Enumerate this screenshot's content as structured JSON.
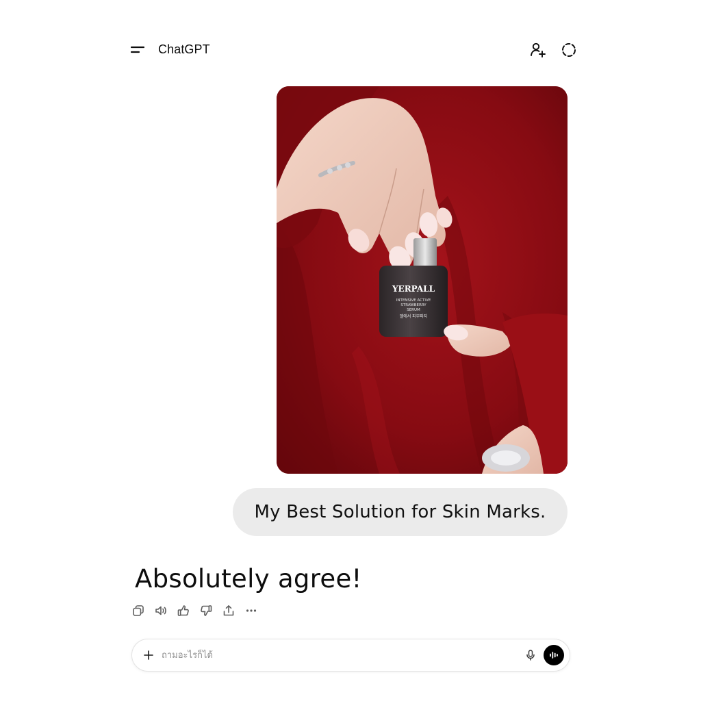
{
  "header": {
    "title": "ChatGPT",
    "menu_icon": "menu-icon",
    "add_person_icon": "add-person-icon",
    "temp_chat_icon": "dashed-circle-icon"
  },
  "conversation": {
    "user_image": {
      "product_brand": "YERPALL",
      "product_lines": [
        "INTENSIVE ACTIVE",
        "STRAWBERRY",
        "SERUM"
      ],
      "product_korean": "멜에서 피부파지",
      "colors": {
        "background": "#8c0b10",
        "bottle": "#3a3436"
      }
    },
    "user_message": "My Best Solution for Skin Marks.",
    "assistant_message": "Absolutely agree!",
    "actions": [
      "copy-icon",
      "read-aloud-icon",
      "thumbs-up-icon",
      "thumbs-down-icon",
      "share-icon",
      "more-icon"
    ]
  },
  "composer": {
    "placeholder": "ถามอะไรก็ได้",
    "value": "",
    "plus_icon": "plus-icon",
    "mic_icon": "mic-icon",
    "voice_icon": "voice-mode-icon"
  },
  "colors": {
    "bubble": "#ebebeb",
    "text": "#0d0d0d",
    "voice_button": "#000000"
  }
}
